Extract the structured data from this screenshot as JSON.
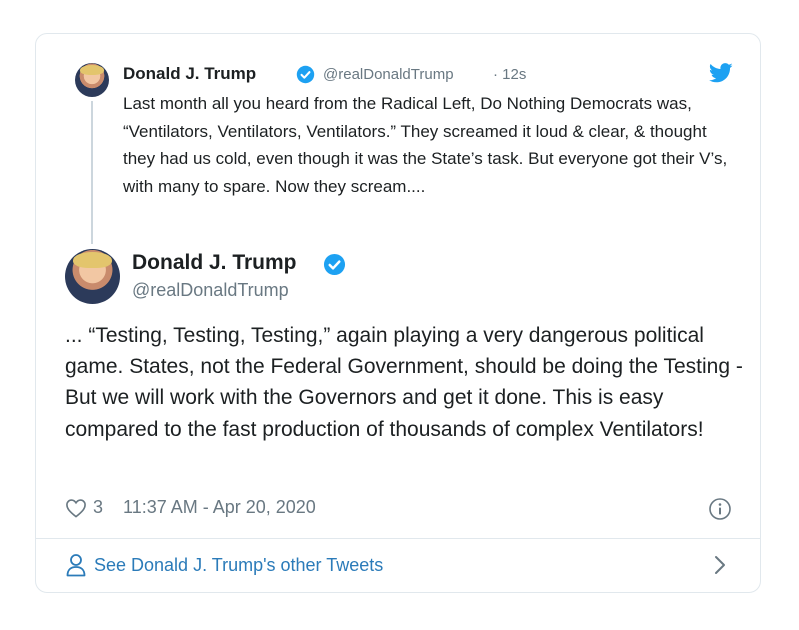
{
  "parent_tweet": {
    "name": "Donald J. Trump",
    "handle": "@realDonaldTrump",
    "time": "· 12s",
    "text": "Last month all you heard from the Radical Left, Do Nothing Democrats was, “Ventilators, Ventilators, Ventilators.” They screamed it loud & clear, & thought they had us cold, even though it was the State’s task. But everyone got their V’s, with many to spare. Now they scream...."
  },
  "main_tweet": {
    "name": "Donald J. Trump",
    "handle": "@realDonaldTrump",
    "text": "... “Testing, Testing, Testing,” again playing a very dangerous political game. States, not the Federal Government, should be doing the Testing - But we will work with the Governors and get it done. This is easy compared to the fast production of thousands of complex Ventilators!",
    "likes": "3",
    "timestamp": "11:37 AM - Apr 20, 2020"
  },
  "footer": {
    "link_label": "See Donald J. Trump's other Tweets"
  },
  "icons": {
    "verified": "verified-badge-icon",
    "brand": "twitter-bird-icon",
    "like": "heart-icon",
    "info": "info-icon",
    "profile": "person-icon",
    "chevron": "chevron-right-icon"
  },
  "colors": {
    "verified_blue": "#1da1f2",
    "link_blue": "#2b7bb9",
    "secondary_text": "#697882",
    "border": "#e1e8ed"
  }
}
